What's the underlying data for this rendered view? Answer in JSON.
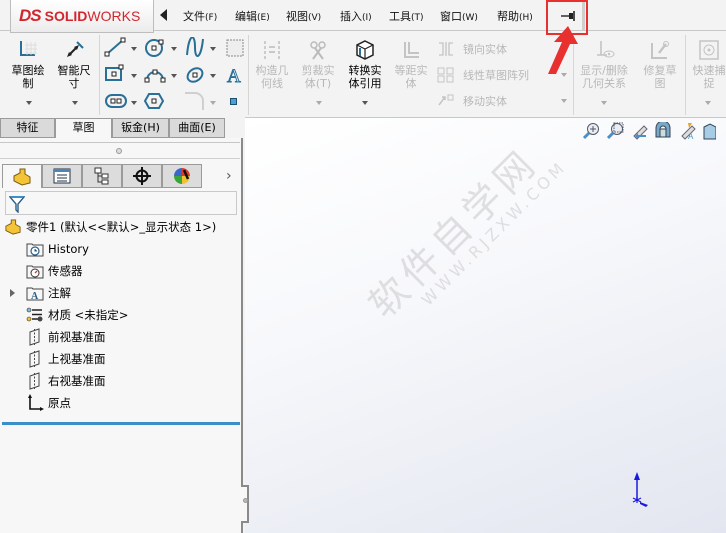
{
  "app": {
    "brand_prefix": "DS",
    "brand_bold": "SOLID",
    "brand_light": "WORKS"
  },
  "menubar": {
    "items": [
      {
        "label": "文件",
        "key": "(F)"
      },
      {
        "label": "编辑",
        "key": "(E)"
      },
      {
        "label": "视图",
        "key": "(V)"
      },
      {
        "label": "插入",
        "key": "(I)"
      },
      {
        "label": "工具",
        "key": "(T)"
      },
      {
        "label": "窗口",
        "key": "(W)"
      },
      {
        "label": "帮助",
        "key": "(H)"
      }
    ],
    "pin_tooltip_icon": "pin-icon",
    "highlight_color": "#e8302f"
  },
  "command_manager": {
    "sketch": {
      "line1": "草图绘",
      "line2": "制"
    },
    "smart_dim": {
      "line1": "智能尺",
      "line2": "寸"
    },
    "construction": {
      "line1": "构造几",
      "line2": "何线"
    },
    "trim": {
      "line1": "剪裁实",
      "line2": "体(T)"
    },
    "convert": {
      "line1": "转换实",
      "line2": "体引用"
    },
    "offset": {
      "line1": "等距实",
      "line2": "体"
    },
    "mirror": "镜向实体",
    "linear_pattern": "线性草图阵列",
    "move": "移动实体",
    "relations": {
      "line1": "显示/删除",
      "line2": "几何关系"
    },
    "repair": {
      "line1": "修复草",
      "line2": "图"
    },
    "quick_snap": {
      "line1": "快速捕",
      "line2": "捉"
    },
    "accent_color": "#2a6f96"
  },
  "tabs": [
    {
      "label": "特征",
      "active": false
    },
    {
      "label": "草图",
      "active": true
    },
    {
      "label": "钣金(H)",
      "active": false
    },
    {
      "label": "曲面(E)",
      "active": false
    }
  ],
  "feature_tree": {
    "root": "零件1  (默认<<默认>_显示状态 1>)",
    "items": [
      {
        "label": "History",
        "icon": "history-folder-icon"
      },
      {
        "label": "传感器",
        "icon": "sensor-folder-icon"
      },
      {
        "label": "注解",
        "icon": "annotation-folder-icon",
        "expandable": true
      },
      {
        "label": "材质 <未指定>",
        "icon": "material-icon"
      },
      {
        "label": "前视基准面",
        "icon": "plane-icon"
      },
      {
        "label": "上视基准面",
        "icon": "plane-icon"
      },
      {
        "label": "右视基准面",
        "icon": "plane-icon"
      },
      {
        "label": "原点",
        "icon": "origin-icon"
      }
    ]
  },
  "watermark": {
    "cn": "软件自学网",
    "en": "WWW.RJZXW.COM"
  },
  "triad_color": "#1a1adf"
}
